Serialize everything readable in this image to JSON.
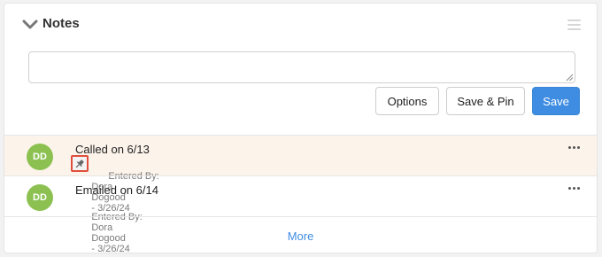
{
  "panel": {
    "title": "Notes",
    "collapse_icon": "chevron-down-icon",
    "menu_icon": "hamburger-menu-icon"
  },
  "composer": {
    "input_value": "",
    "input_placeholder": "",
    "buttons": {
      "options_label": "Options",
      "save_pin_label": "Save & Pin",
      "save_label": "Save"
    }
  },
  "notes": [
    {
      "avatar_initials": "DD",
      "text": "Called on 6/13",
      "entered_by_label": "Entered By:",
      "first_name": "Dora",
      "last_name": "Dogood",
      "date": "- 3/26/24",
      "pinned": true
    },
    {
      "avatar_initials": "DD",
      "text": "Emailed on 6/14",
      "entered_by_label": "Entered By:",
      "first_name": "Dora",
      "last_name": "Dogood",
      "date": "- 3/26/24",
      "pinned": false
    }
  ],
  "footer": {
    "more_label": "More"
  },
  "colors": {
    "primary": "#3f8de2",
    "avatar": "#8cc152",
    "pinned_row_bg": "#fcf3ea",
    "pin_highlight_border": "#e04e3c"
  }
}
